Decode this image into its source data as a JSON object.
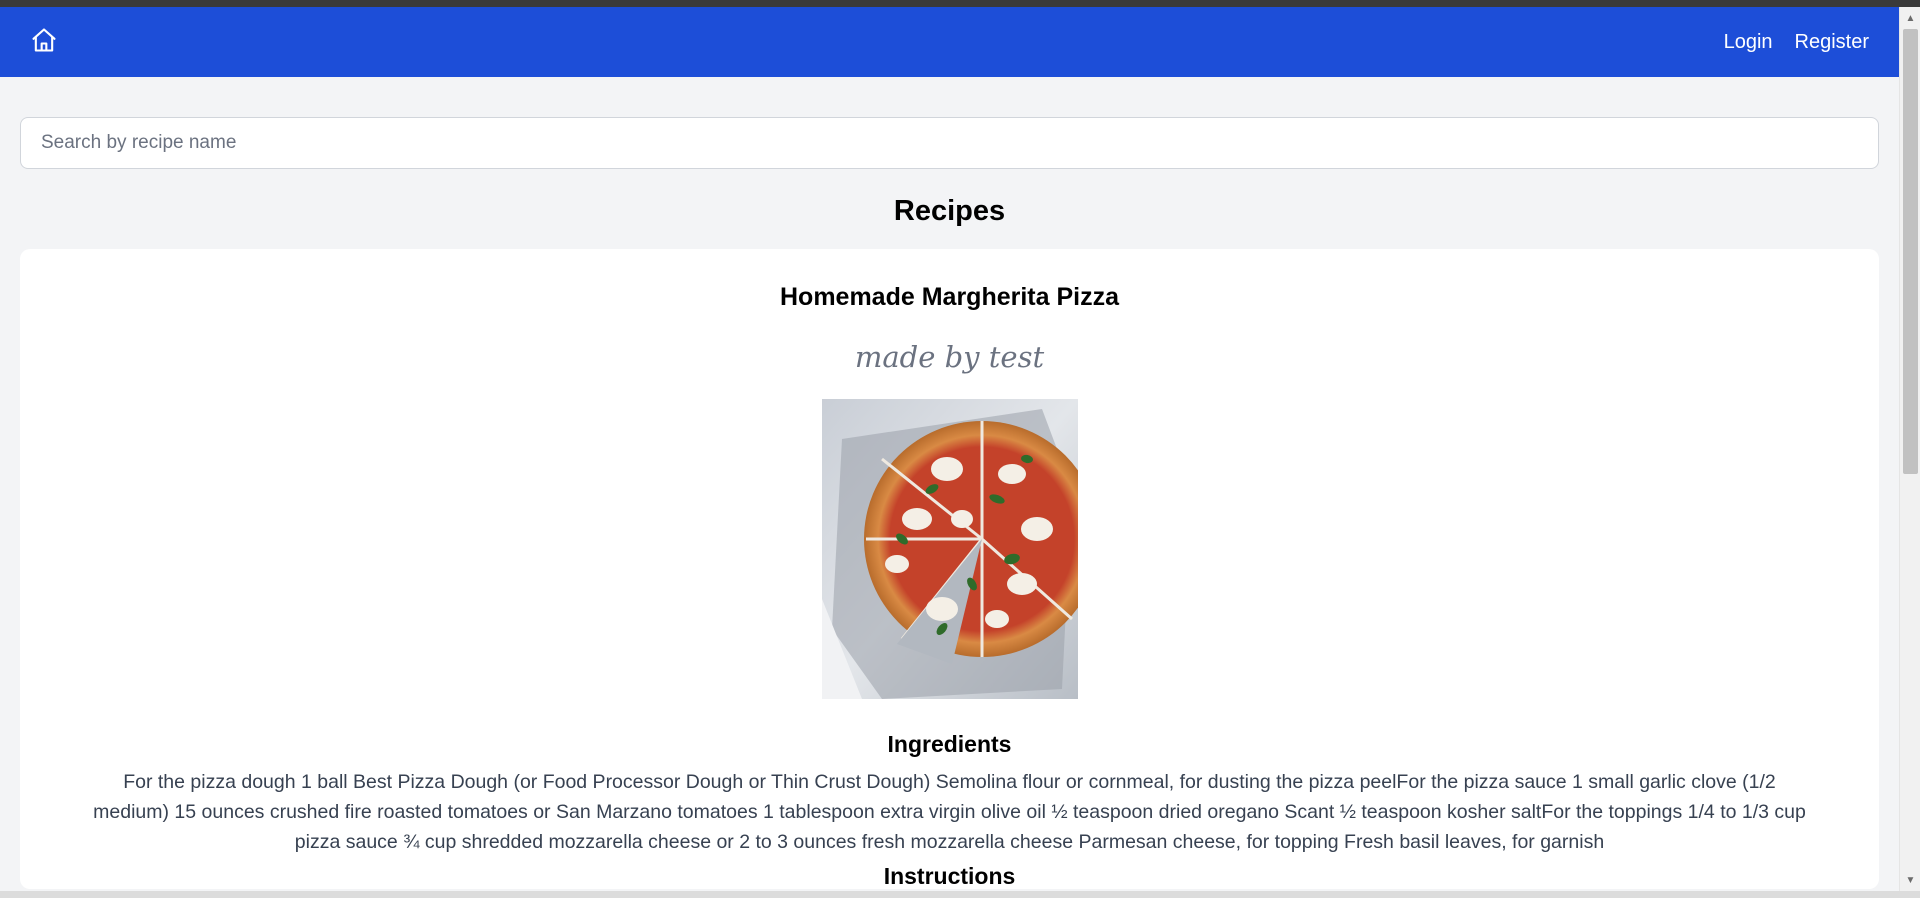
{
  "navbar": {
    "home_icon": "home-icon",
    "login_label": "Login",
    "register_label": "Register",
    "color": "#1d4ed8"
  },
  "search": {
    "placeholder": "Search by recipe name",
    "value": ""
  },
  "page": {
    "title": "Recipes"
  },
  "recipe": {
    "title": "Homemade Margherita Pizza",
    "author": "made by test",
    "image_alt": "pizza-image",
    "ingredients_heading": "Ingredients",
    "ingredients_text": "For the pizza dough 1 ball Best Pizza Dough (or Food Processor Dough or Thin Crust Dough) Semolina flour or cornmeal, for dusting the pizza peelFor the pizza sauce 1 small garlic clove (1/2 medium) 15 ounces crushed fire roasted tomatoes or San Marzano tomatoes 1 tablespoon extra virgin olive oil ½ teaspoon dried oregano Scant ½ teaspoon kosher saltFor the toppings 1/4 to 1/3 cup pizza sauce ¾ cup shredded mozzarella cheese or 2 to 3 ounces fresh mozzarella cheese Parmesan cheese, for topping Fresh basil leaves, for garnish",
    "instructions_heading": "Instructions"
  }
}
